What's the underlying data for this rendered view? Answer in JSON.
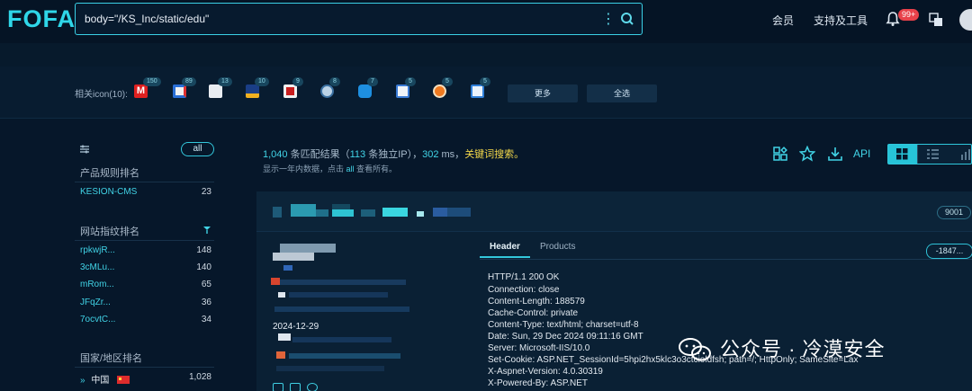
{
  "app": {
    "logo": "FOFA"
  },
  "search": {
    "query": "body=\"/KS_Inc/static/edu\""
  },
  "topnav": {
    "member": "会员",
    "support": "支持及工具",
    "notif_badge": "99+"
  },
  "icon_bar": {
    "label": "相关icon(10):",
    "counts": [
      "150",
      "89",
      "13",
      "10",
      "9",
      "8",
      "7",
      "5",
      "5",
      "5"
    ],
    "more": "更多",
    "select_all": "全选"
  },
  "left": {
    "all": "all",
    "product_title": "产品规则排名",
    "products": [
      {
        "name": "KESION-CMS",
        "count": "23"
      }
    ],
    "fingerprint_title": "网站指纹排名",
    "fingerprints": [
      {
        "name": "rpkwjR...",
        "count": "148"
      },
      {
        "name": "3cMLu...",
        "count": "140"
      },
      {
        "name": "mRom...",
        "count": "65"
      },
      {
        "name": "JFqZr...",
        "count": "36"
      },
      {
        "name": "7ocvtC...",
        "count": "34"
      }
    ],
    "country_title": "国家/地区排名",
    "countries": [
      {
        "name": "中国",
        "count": "1,028"
      }
    ]
  },
  "summary": {
    "count": "1,040",
    "text1": " 条匹配结果（",
    "unique": "113",
    "text2": " 条独立IP），",
    "ms": "302",
    "text3": " ms，",
    "keyword": "关键词搜索。",
    "hint_pre": "显示一年内数据，点击 ",
    "hint_all": "all",
    "hint_post": " 查看所有。"
  },
  "toolbar": {
    "api": "API"
  },
  "result": {
    "port": "9001",
    "date": "2024-12-29",
    "tab_header": "Header",
    "tab_products": "Products",
    "hash": "-1847...",
    "headers": [
      "HTTP/1.1 200 OK",
      "Connection: close",
      "Content-Length: 188579",
      "Cache-Control: private",
      "Content-Type: text/html; charset=utf-8",
      "Date: Sun, 29 Dec 2024 09:11:16 GMT",
      "Server: Microsoft-IIS/10.0",
      "Set-Cookie: ASP.NET_SessionId=5hpi2hx5klc3o3ctcioldfsh; path=/; HttpOnly; SameSite=Lax",
      "X-Aspnet-Version: 4.0.30319",
      "X-Powered-By: ASP.NET"
    ]
  },
  "watermark": "公众号 · 冷漠安全",
  "colors": {
    "accent": "#33c8dc",
    "background": "#06172a",
    "highlight": "#f4d94a"
  }
}
